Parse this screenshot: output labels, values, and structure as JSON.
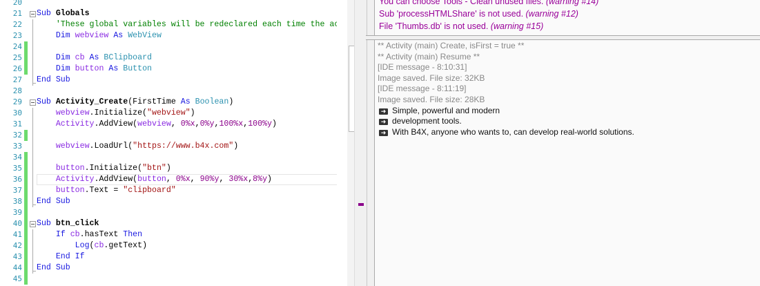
{
  "editor": {
    "lines": [
      {
        "n": "20",
        "changed": false,
        "tokens": []
      },
      {
        "n": "21",
        "changed": false,
        "fold": true,
        "tokens": [
          [
            "Sub ",
            "kw"
          ],
          [
            "Globals",
            "bold"
          ]
        ]
      },
      {
        "n": "22",
        "changed": false,
        "guide": true,
        "tokens": [
          [
            "    'These global variables will be redeclared each time the act",
            "cm"
          ]
        ]
      },
      {
        "n": "23",
        "changed": false,
        "guide": true,
        "tokens": [
          [
            "    Dim ",
            "kw"
          ],
          [
            "webview ",
            "var"
          ],
          [
            "As ",
            "kw"
          ],
          [
            "WebView",
            "ty"
          ]
        ]
      },
      {
        "n": "24",
        "changed": true,
        "guide": true,
        "tokens": []
      },
      {
        "n": "25",
        "changed": true,
        "guide": true,
        "tokens": [
          [
            "    Dim ",
            "kw"
          ],
          [
            "cb ",
            "var"
          ],
          [
            "As ",
            "kw"
          ],
          [
            "BClipboard",
            "ty"
          ]
        ]
      },
      {
        "n": "26",
        "changed": true,
        "guide": true,
        "tokens": [
          [
            "    Dim ",
            "kw"
          ],
          [
            "button ",
            "var"
          ],
          [
            "As ",
            "kw"
          ],
          [
            "Button",
            "ty"
          ]
        ]
      },
      {
        "n": "27",
        "changed": false,
        "guide": "end",
        "tokens": [
          [
            "End Sub",
            "kw"
          ]
        ]
      },
      {
        "n": "28",
        "changed": false,
        "tokens": []
      },
      {
        "n": "29",
        "changed": false,
        "fold": true,
        "tokens": [
          [
            "Sub ",
            "kw"
          ],
          [
            "Activity_Create",
            "bold"
          ],
          [
            "(FirstTime ",
            "id"
          ],
          [
            "As ",
            "kw"
          ],
          [
            "Boolean",
            "ty"
          ],
          [
            ")",
            "id"
          ]
        ]
      },
      {
        "n": "30",
        "changed": false,
        "guide": true,
        "tokens": [
          [
            "    webview",
            "var"
          ],
          [
            ".Initialize(",
            "id"
          ],
          [
            "\"webview\"",
            "str"
          ],
          [
            ")",
            "id"
          ]
        ]
      },
      {
        "n": "31",
        "changed": false,
        "guide": true,
        "tokens": [
          [
            "    Activity",
            "var"
          ],
          [
            ".AddView(",
            "id"
          ],
          [
            "webview",
            "var"
          ],
          [
            ", ",
            "id"
          ],
          [
            "0%x",
            "num"
          ],
          [
            ",",
            "id"
          ],
          [
            "0%y",
            "num"
          ],
          [
            ",",
            "id"
          ],
          [
            "100%x",
            "num"
          ],
          [
            ",",
            "id"
          ],
          [
            "100%y",
            "num"
          ],
          [
            ")",
            "id"
          ]
        ]
      },
      {
        "n": "32",
        "changed": true,
        "guide": true,
        "tokens": []
      },
      {
        "n": "33",
        "changed": false,
        "guide": true,
        "tokens": [
          [
            "    webview",
            "var"
          ],
          [
            ".LoadUrl(",
            "id"
          ],
          [
            "\"https://www.b4x.com\"",
            "str"
          ],
          [
            ")",
            "id"
          ]
        ]
      },
      {
        "n": "34",
        "changed": true,
        "guide": true,
        "tokens": []
      },
      {
        "n": "35",
        "changed": true,
        "guide": true,
        "tokens": [
          [
            "    button",
            "var"
          ],
          [
            ".Initialize(",
            "id"
          ],
          [
            "\"btn\"",
            "str"
          ],
          [
            ")",
            "id"
          ]
        ]
      },
      {
        "n": "36",
        "changed": true,
        "guide": true,
        "current": true,
        "tokens": [
          [
            "    Activity",
            "var"
          ],
          [
            ".AddView(",
            "id"
          ],
          [
            "button",
            "var"
          ],
          [
            ", ",
            "id"
          ],
          [
            "0%x",
            "num"
          ],
          [
            ", ",
            "id"
          ],
          [
            "90%y",
            "num"
          ],
          [
            ", ",
            "id"
          ],
          [
            "30%x",
            "num"
          ],
          [
            ",",
            "id"
          ],
          [
            "8%y",
            "num"
          ],
          [
            ")",
            "id"
          ]
        ]
      },
      {
        "n": "37",
        "changed": true,
        "guide": true,
        "tokens": [
          [
            "    button",
            "var"
          ],
          [
            ".Text = ",
            "id"
          ],
          [
            "\"clipboard\"",
            "str"
          ]
        ]
      },
      {
        "n": "38",
        "changed": true,
        "guide": "end",
        "tokens": [
          [
            "End Sub",
            "kw"
          ]
        ]
      },
      {
        "n": "39",
        "changed": true,
        "tokens": []
      },
      {
        "n": "40",
        "changed": true,
        "fold": true,
        "tokens": [
          [
            "Sub ",
            "kw"
          ],
          [
            "btn_click",
            "bold"
          ]
        ]
      },
      {
        "n": "41",
        "changed": true,
        "guide": true,
        "tokens": [
          [
            "    If ",
            "kw"
          ],
          [
            "cb",
            "var"
          ],
          [
            ".hasText ",
            "id"
          ],
          [
            "Then",
            "kw"
          ]
        ]
      },
      {
        "n": "42",
        "changed": true,
        "guide": true,
        "tokens": [
          [
            "        Log",
            "kw"
          ],
          [
            "(",
            "id"
          ],
          [
            "cb",
            "var"
          ],
          [
            ".getText)",
            "id"
          ]
        ]
      },
      {
        "n": "43",
        "changed": true,
        "guide": true,
        "tokens": [
          [
            "    End If",
            "kw"
          ]
        ]
      },
      {
        "n": "44",
        "changed": true,
        "guide": "end",
        "tokens": [
          [
            "End Sub",
            "kw"
          ]
        ]
      },
      {
        "n": "45",
        "changed": true,
        "tokens": []
      }
    ]
  },
  "warnings": [
    {
      "text": "You can choose Tools - Clean unused files. ",
      "tag": "(warning #14)"
    },
    {
      "text": "Sub 'processHTMLShare' is not used. ",
      "tag": "(warning #12)"
    },
    {
      "text": "File 'Thumbs.db' is not used. ",
      "tag": "(warning #15)"
    }
  ],
  "logs": [
    {
      "text": "** Activity (main) Create, isFirst = true **",
      "type": "system"
    },
    {
      "text": "** Activity (main) Resume **",
      "type": "system"
    },
    {
      "text": "[IDE message - 8:10:31]",
      "type": "system"
    },
    {
      "text": "Image saved. File size: 32KB",
      "type": "system"
    },
    {
      "text": "[IDE message - 8:11:19]",
      "type": "system"
    },
    {
      "text": "Image saved. File size: 28KB",
      "type": "system"
    },
    {
      "text": "Simple, powerful and modern",
      "type": "message"
    },
    {
      "text": "development tools.",
      "type": "message"
    },
    {
      "text": "With B4X, anyone who wants to, can develop real-world solutions.",
      "type": "message"
    }
  ],
  "colors": {
    "change_bar": "#6ddb6d",
    "warning_text": "#990099",
    "error_marker": "#8b008b"
  }
}
